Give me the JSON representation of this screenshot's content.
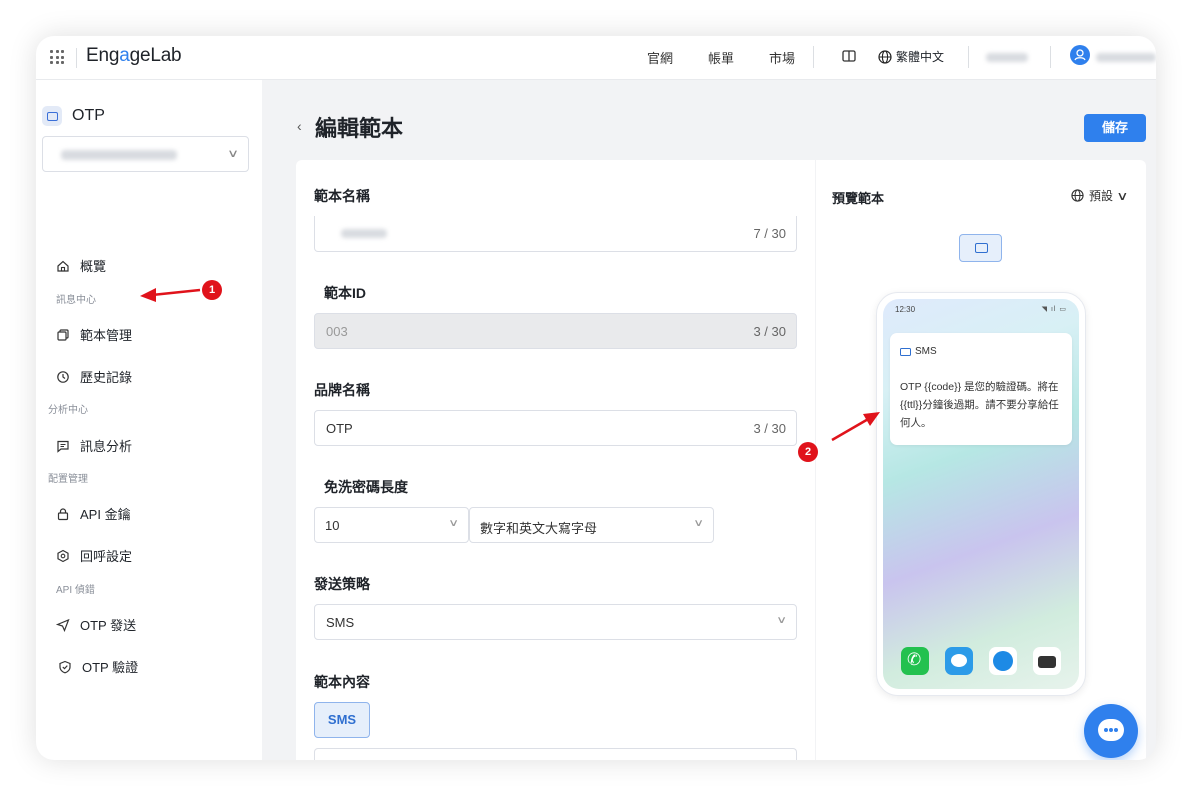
{
  "header": {
    "logo_prefix": "Eng",
    "logo_accent": "a",
    "logo_suffix": "geLab",
    "nav": [
      "官網",
      "帳單",
      "市場"
    ],
    "language": "繁體中文"
  },
  "sidebar": {
    "app_name": "OTP",
    "items": [
      {
        "label": "概覽",
        "icon": "home-icon"
      },
      {
        "label": "範本管理",
        "icon": "template-icon"
      },
      {
        "label": "歷史記錄",
        "icon": "history-icon"
      },
      {
        "label": "訊息分析",
        "icon": "message-icon"
      },
      {
        "label": "API 金鑰",
        "icon": "lock-icon"
      },
      {
        "label": "回呼設定",
        "icon": "hexagon-icon"
      },
      {
        "label": "OTP 發送",
        "icon": "send-icon"
      },
      {
        "label": "OTP 驗證",
        "icon": "shield-icon"
      }
    ],
    "groups": [
      "訊息中心",
      "分析中心",
      "配置管理",
      "API 偵錯"
    ]
  },
  "page": {
    "title": "編輯範本",
    "save_label": "儲存"
  },
  "form": {
    "template_name_label": "範本名稱",
    "template_name_count": "7 / 30",
    "template_id_label": "範本ID",
    "template_id_value": "003",
    "template_id_count": "3 / 30",
    "brand_label": "品牌名稱",
    "brand_value": "OTP",
    "brand_count": "3 / 30",
    "code_length_label": "免洗密碼長度",
    "code_length_value": "10",
    "code_type_value": "數字和英文大寫字母",
    "strategy_label": "發送策略",
    "strategy_value": "SMS",
    "content_label": "範本內容",
    "content_tab": "SMS"
  },
  "preview": {
    "title": "預覽範本",
    "language": "預設",
    "status_time": "12:30",
    "message_sender": "SMS",
    "message_body": "OTP {{code}} 是您的驗證碼。將在{{ttl}}分鐘後過期。請不要分享給任何人。"
  },
  "annotations": {
    "badge_1": "1",
    "badge_2": "2"
  },
  "colors": {
    "primary": "#2f80ed",
    "annotation": "#e0131b"
  }
}
